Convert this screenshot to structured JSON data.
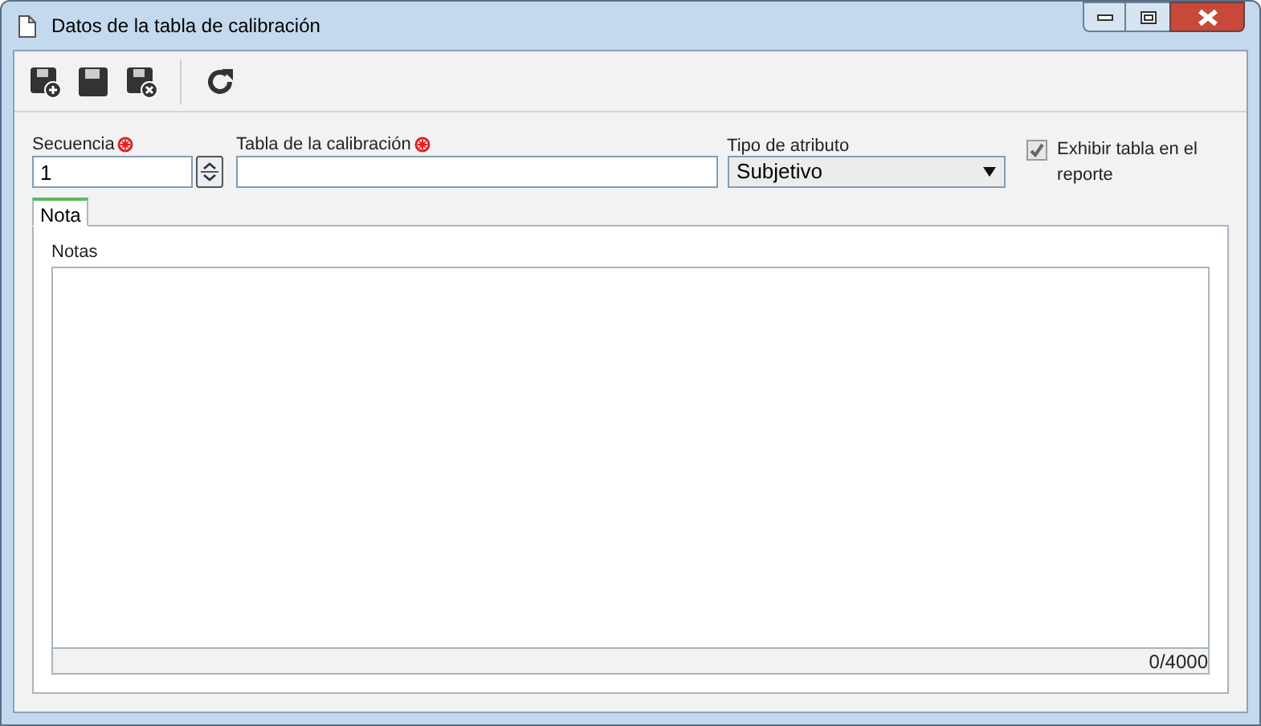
{
  "window": {
    "title": "Datos de la tabla de calibración"
  },
  "toolbar": [
    {
      "kind": "save-new"
    },
    {
      "kind": "save"
    },
    {
      "kind": "save-close"
    },
    {
      "kind": "refresh"
    }
  ],
  "fields": {
    "sequence": {
      "label": "Secuencia",
      "required": true,
      "value": "1"
    },
    "table": {
      "label": "Tabla de la calibración",
      "required": true
    },
    "attribute_type": {
      "label": "Tipo de atributo",
      "value": "Subjetivo"
    },
    "show_in_report": {
      "label": "Exhibir tabla en el reporte",
      "checked": true
    }
  },
  "tabs": [
    {
      "label": "Nota",
      "selected": true
    }
  ],
  "notes": {
    "label": "Notas",
    "counter": "0/4000"
  }
}
